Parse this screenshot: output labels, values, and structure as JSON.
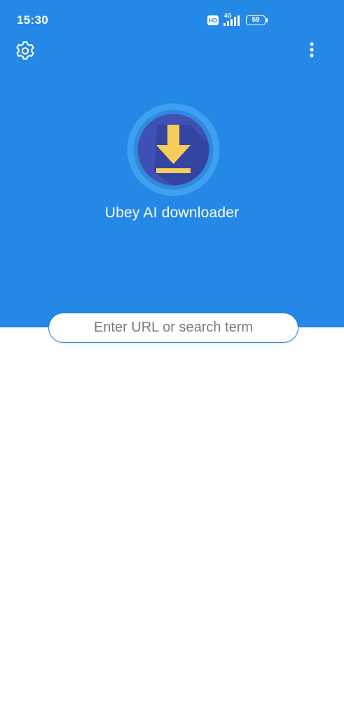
{
  "status_bar": {
    "time": "15:30",
    "hd_label": "HD",
    "network_label": "4G",
    "battery_level": "59"
  },
  "toolbar": {
    "settings_icon": "gear-icon",
    "menu_icon": "more-vert-icon"
  },
  "header": {
    "logo_icon": "download-icon",
    "app_title": "Ubey AI downloader"
  },
  "search": {
    "placeholder": "Enter URL or search term",
    "value": ""
  },
  "colors": {
    "primary": "#2488E6",
    "logo_ring": "#3FA0F0",
    "logo_inner": "#3F51B5",
    "logo_arrow": "#F6CD58",
    "background": "#FFFFFF"
  }
}
